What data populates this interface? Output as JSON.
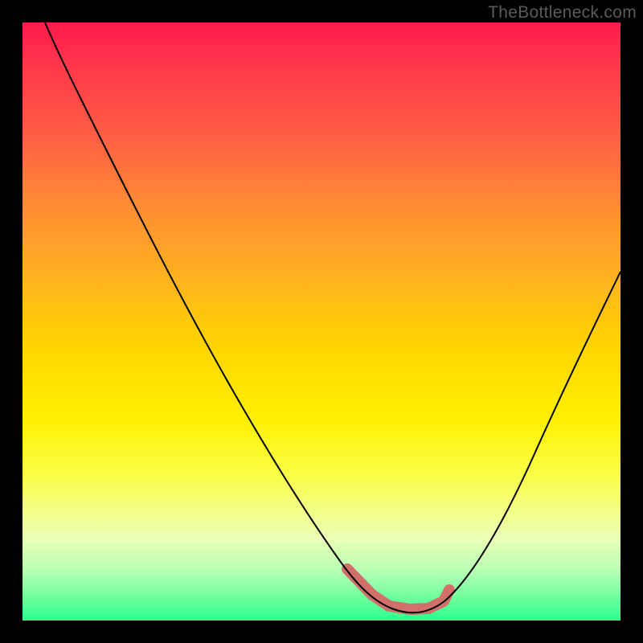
{
  "watermark": "TheBottleneck.com",
  "colors": {
    "backdrop": "#000000",
    "curve": "#000000",
    "highlight": "#d1706b"
  },
  "chart_data": {
    "type": "line",
    "title": "",
    "xlabel": "",
    "ylabel": "",
    "xlim": [
      0,
      100
    ],
    "ylim": [
      0,
      100
    ],
    "grid": false,
    "legend": false,
    "x": [
      4,
      8,
      12,
      16,
      20,
      24,
      28,
      32,
      36,
      40,
      44,
      48,
      52,
      56,
      60,
      62,
      64,
      66,
      68,
      72,
      76,
      80,
      84,
      88,
      92,
      96,
      100
    ],
    "values": [
      100,
      93,
      86,
      79,
      72,
      65,
      58,
      51,
      44,
      38,
      31,
      24,
      18,
      12,
      6.5,
      3.5,
      1.5,
      0.7,
      0.5,
      0.7,
      2,
      5,
      10,
      18,
      28,
      38,
      50
    ],
    "highlight_x_range": [
      56,
      71
    ],
    "description": "V-shaped bottleneck curve with minimum near x≈67; highlighted sweet-spot segment roughly x 56–71 at the valley floor."
  }
}
